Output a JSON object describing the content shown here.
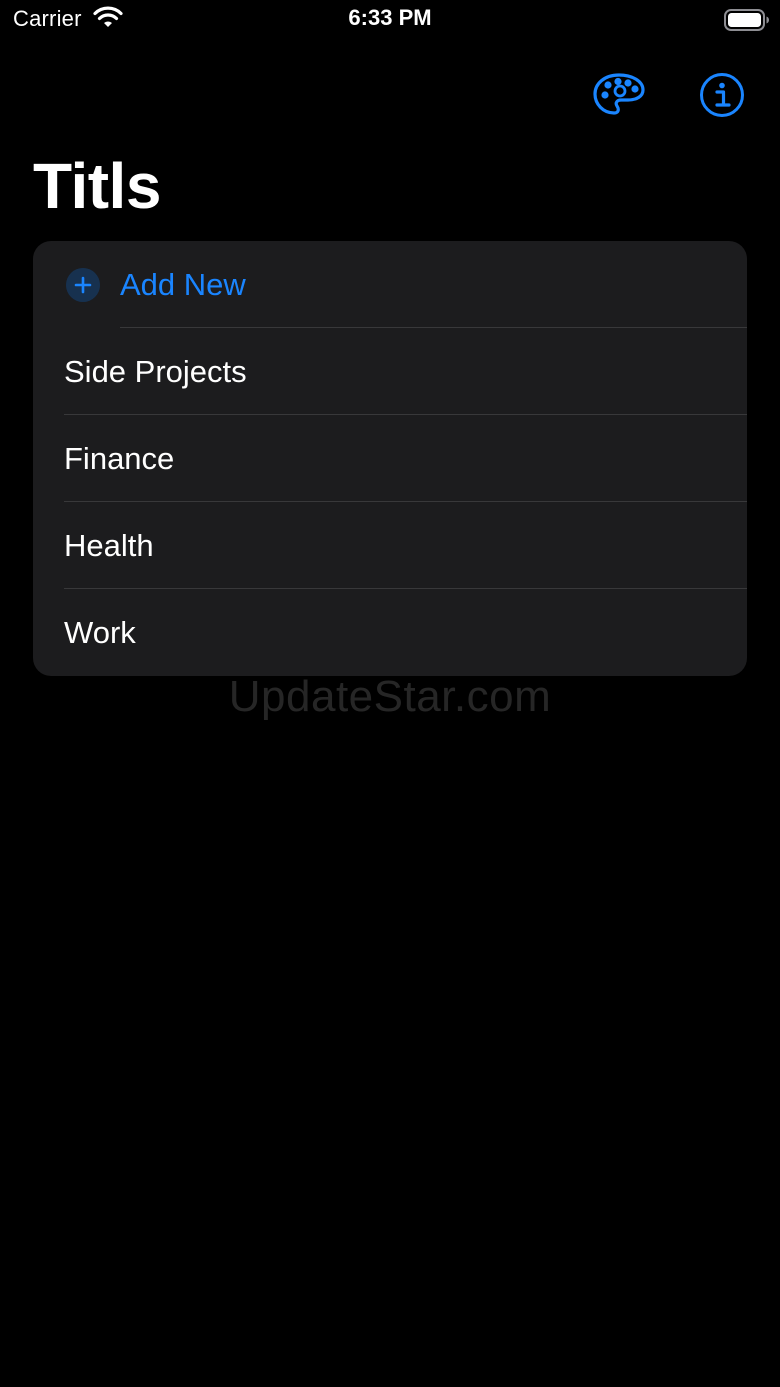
{
  "status_bar": {
    "carrier": "Carrier",
    "time": "6:33 PM",
    "wifi_icon": "wifi-icon",
    "battery_icon": "battery-full-icon"
  },
  "nav": {
    "palette_icon": "palette-icon",
    "info_icon": "info-icon",
    "title": "Titls"
  },
  "list": {
    "add_label": "Add New",
    "add_icon": "plus-circle-icon",
    "items": [
      {
        "label": "Side Projects"
      },
      {
        "label": "Finance"
      },
      {
        "label": "Health"
      },
      {
        "label": "Work"
      }
    ]
  },
  "watermark": "UpdateStar.com",
  "colors": {
    "background": "#000000",
    "card": "#1c1c1e",
    "accent": "#1a85ff",
    "separator": "#38383a"
  }
}
